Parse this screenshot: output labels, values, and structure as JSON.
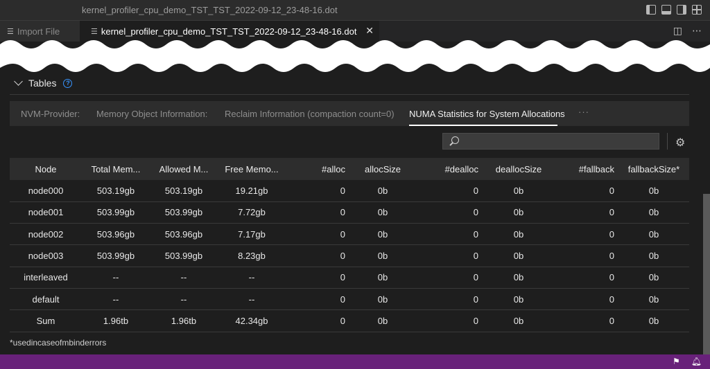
{
  "window": {
    "title": "kernel_profiler_cpu_demo_TST_TST_2022-09-12_23-48-16.dot"
  },
  "tabs": [
    {
      "label": "Import File"
    },
    {
      "label": "kernel_profiler_cpu_demo_TST_TST_2022-09-12_23-48-16.dot"
    }
  ],
  "section": {
    "title": "Tables"
  },
  "table_tabs": [
    {
      "label": "NVM-Provider:"
    },
    {
      "label": "Memory Object Information:"
    },
    {
      "label": "Reclaim Information (compaction count=0)"
    },
    {
      "label": "NUMA Statistics for System Allocations"
    }
  ],
  "more_tabs_label": "···",
  "search": {
    "placeholder": ""
  },
  "columns": [
    "Node",
    "Total Mem...",
    "Allowed M...",
    "Free Memo...",
    "#alloc",
    "allocSize",
    "#dealloc",
    "deallocSize",
    "#fallback",
    "fallbackSize*"
  ],
  "rows": [
    [
      "node000",
      "503.19gb",
      "503.19gb",
      "19.21gb",
      "0",
      "0b",
      "0",
      "0b",
      "0",
      "0b"
    ],
    [
      "node001",
      "503.99gb",
      "503.99gb",
      "7.72gb",
      "0",
      "0b",
      "0",
      "0b",
      "0",
      "0b"
    ],
    [
      "node002",
      "503.96gb",
      "503.96gb",
      "7.17gb",
      "0",
      "0b",
      "0",
      "0b",
      "0",
      "0b"
    ],
    [
      "node003",
      "503.99gb",
      "503.99gb",
      "8.23gb",
      "0",
      "0b",
      "0",
      "0b",
      "0",
      "0b"
    ],
    [
      "interleaved",
      "--",
      "--",
      "--",
      "0",
      "0b",
      "0",
      "0b",
      "0",
      "0b"
    ],
    [
      "default",
      "--",
      "--",
      "--",
      "0",
      "0b",
      "0",
      "0b",
      "0",
      "0b"
    ],
    [
      "Sum",
      "1.96tb",
      "1.96tb",
      "42.34gb",
      "0",
      "0b",
      "0",
      "0b",
      "0",
      "0b"
    ]
  ],
  "footnote": "*usedincaseofmbinderrors",
  "colors": {
    "statusbar": "#68217a",
    "accent": "#3794ff"
  }
}
